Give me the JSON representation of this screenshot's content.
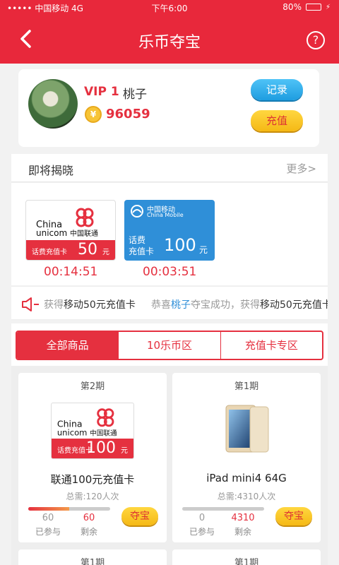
{
  "status_bar": {
    "carrier": "••••• 中国移动  4G",
    "time": "下午6:00",
    "battery": "80%",
    "battery_level": 0.8
  },
  "header": {
    "title": "乐币夺宝",
    "help": "?"
  },
  "user": {
    "vip": "VIP 1",
    "name": "桃子",
    "coins": "96059",
    "record_button": "记录",
    "recharge_button": "充值"
  },
  "coming_soon": {
    "title": "即将揭晓",
    "more": "更多>",
    "items": [
      {
        "logo_en1": "China",
        "logo_en2": "unicom",
        "logo_cn": "中国联通",
        "label": "话费充值卡",
        "value": "50",
        "unit": "元",
        "timer": "00:14:51"
      },
      {
        "logo_cn": "中国移动",
        "logo_en": "China Mobile",
        "label1": "话费",
        "label2": "充值卡",
        "value": "100",
        "unit": "元",
        "timer": "00:03:51"
      }
    ]
  },
  "marquee": {
    "m1_a": "获得",
    "m1_b": "移动50元充值卡",
    "m2_a": "恭喜",
    "m2_user": "桃子",
    "m2_b": "夺宝成功，获得",
    "m2_c": "移动50元充值卡"
  },
  "tabs": [
    "全部商品",
    "10乐币区",
    "充值卡专区"
  ],
  "products": [
    {
      "period": "第2期",
      "name": "联通100元充值卡",
      "need": "总需:120人次",
      "joined": "60",
      "remaining": "60",
      "joined_label": "已参与",
      "remaining_label": "剩余",
      "button": "夺宝",
      "progress": 0.5,
      "card": {
        "logo_en1": "China",
        "logo_en2": "unicom",
        "logo_cn": "中国联通",
        "label": "话费充值卡",
        "value": "100",
        "unit": "元"
      }
    },
    {
      "period": "第1期",
      "name": "iPad mini4 64G",
      "need": "总需:4310人次",
      "joined": "0",
      "remaining": "4310",
      "joined_label": "已参与",
      "remaining_label": "剩余",
      "button": "夺宝",
      "progress": 0
    },
    {
      "period": "第1期"
    },
    {
      "period": "第1期"
    }
  ],
  "colors": {
    "brand_red": "#e8283b",
    "blue": "#2f8fd8",
    "gold": "#f5b915"
  },
  "icons": {
    "back": "chevron-left-icon",
    "help": "question-circle-icon",
    "coin": "coin-icon",
    "speaker": "speaker-icon"
  }
}
